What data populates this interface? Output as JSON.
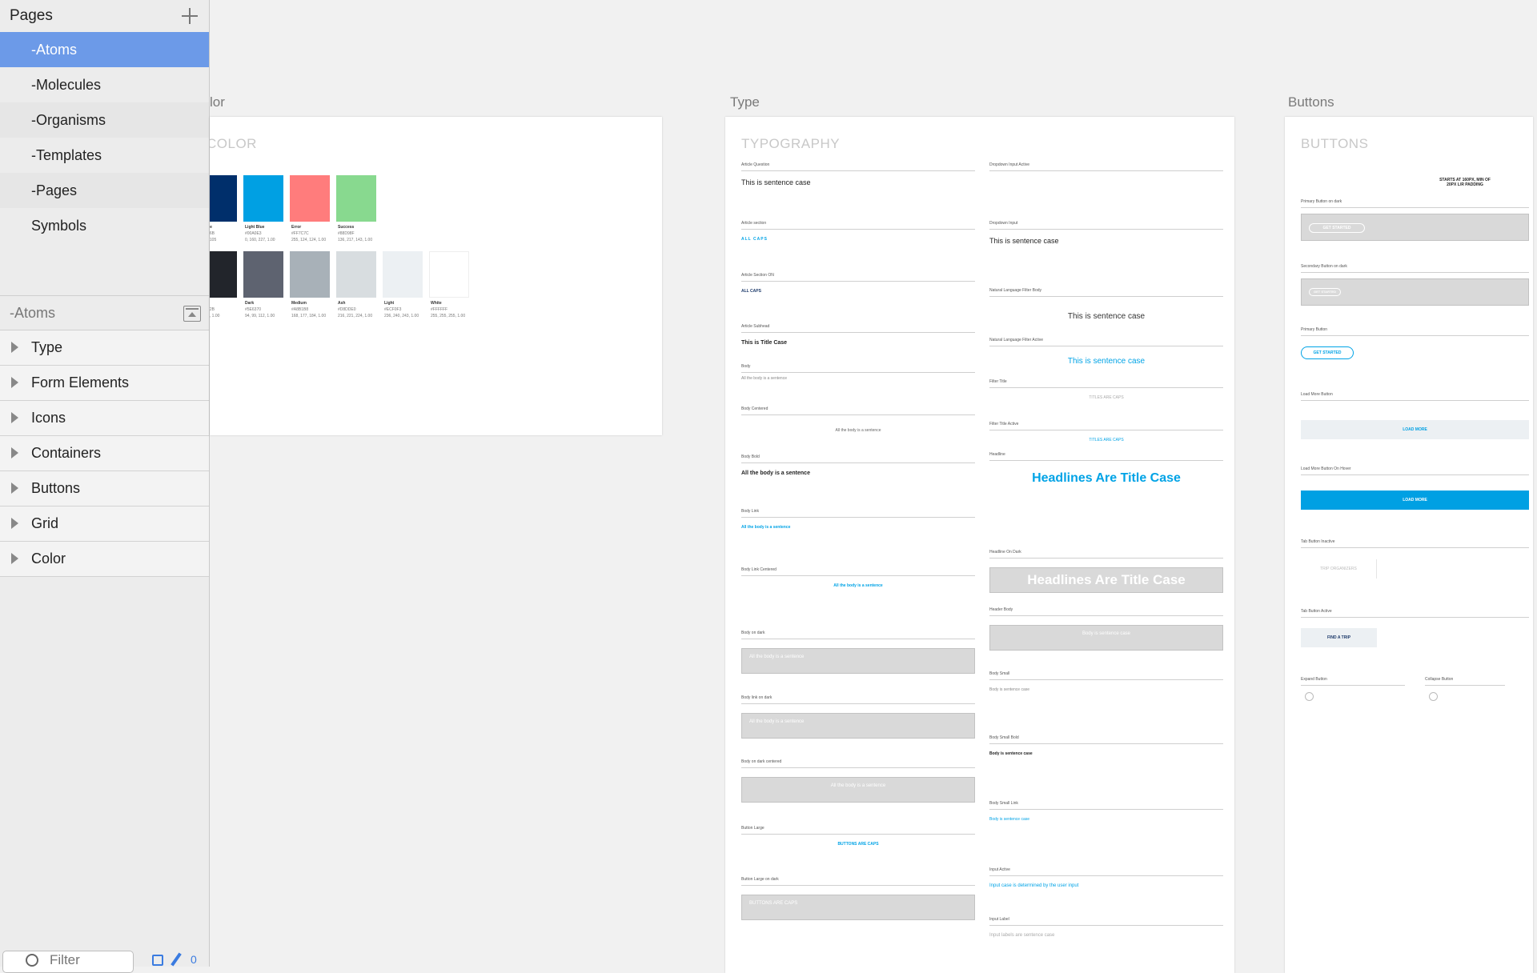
{
  "sidebar": {
    "pages_title": "Pages",
    "pages": [
      "-Atoms",
      "-Molecules",
      "-Organisms",
      "-Templates",
      "-Pages",
      "Symbols"
    ],
    "current_page": "-Atoms",
    "layers": [
      "Type",
      "Form Elements",
      "Icons",
      "Containers",
      "Buttons",
      "Grid",
      "Color"
    ],
    "filter_placeholder": "Filter",
    "count": "0"
  },
  "colors": {
    "accent": "#6c9ae8",
    "blue": "#00a3e6"
  },
  "color_board": {
    "label": "lor",
    "title": "COLOR",
    "swatches_row1": [
      {
        "name": "rk Blue",
        "hex": "#00306B",
        "rgb": "0, 47, 105",
        "color": "#002f6b"
      },
      {
        "name": "Light Blue",
        "hex": "#00A0E3",
        "rgb": "0, 160, 227, 1.00",
        "color": "#00a0e3"
      },
      {
        "name": "Error",
        "hex": "#FF7C7C",
        "rgb": "255, 124, 124, 1.00",
        "color": "#ff7c7c"
      },
      {
        "name": "Success",
        "hex": "#88D98F",
        "rgb": "136, 217, 143, 1.00",
        "color": "#88d98f"
      }
    ],
    "swatches_row2": [
      {
        "name": "ack",
        "hex": "#22252B",
        "rgb": "37, 41, 1.00",
        "color": "#22252b"
      },
      {
        "name": "Dark",
        "hex": "#5E6370",
        "rgb": "94, 99, 112, 1.00",
        "color": "#5e6370"
      },
      {
        "name": "Medium",
        "hex": "#A8B1B8",
        "rgb": "168, 177, 184, 1.00",
        "color": "#a8b1b8"
      },
      {
        "name": "Ash",
        "hex": "#D8DDE0",
        "rgb": "216, 221, 224, 1.00",
        "color": "#d8dde0"
      },
      {
        "name": "Light",
        "hex": "#ECF0F3",
        "rgb": "236, 240, 243, 1.00",
        "color": "#ecf0f3"
      },
      {
        "name": "White",
        "hex": "#FFFFFF",
        "rgb": "255, 255, 255, 1.00",
        "color": "#ffffff"
      }
    ]
  },
  "type_board": {
    "label": "Type",
    "title": "TYPOGRAPHY",
    "left": [
      {
        "label": "Article Question",
        "sample": "This is sentence case"
      },
      {
        "label": "Article section",
        "sample": "ALL CAPS"
      },
      {
        "label": "Article Section ON",
        "sample": "ALL CAPS"
      },
      {
        "label": "Article Subhead",
        "sample": "This is Title Case"
      },
      {
        "label": "Body",
        "sample": "All the body is a sentence"
      },
      {
        "label": "Body Centered",
        "sample": "All the body is a sentence"
      },
      {
        "label": "Body Bold",
        "sample": "All the body is a sentence"
      },
      {
        "label": "Body Link",
        "sample": "All the body is a sentence"
      },
      {
        "label": "Body Link Centered",
        "sample": "All the body is a sentence"
      },
      {
        "label": "Body on dark",
        "sample": "All the body is a sentence"
      },
      {
        "label": "Body link on dark",
        "sample": "All the body is a sentence"
      },
      {
        "label": "Body on dark centered",
        "sample": "All the body is a sentence"
      },
      {
        "label": "Button Large",
        "sample": "BUTTONS ARE CAPS"
      },
      {
        "label": "Button Large on dark",
        "sample": "BUTTONS ARE CAPS"
      }
    ],
    "right": [
      {
        "label": "Dropdown Input Active",
        "sample": ""
      },
      {
        "label": "Dropdown Input",
        "sample": "This is sentence case"
      },
      {
        "label": "Natural Language Filter Body",
        "sample": "This is sentence case"
      },
      {
        "label": "Natural Language Filter Active",
        "sample": "This is sentence case"
      },
      {
        "label": "Filter Title",
        "sample": "TITLES ARE CAPS"
      },
      {
        "label": "Filter Title Active",
        "sample": "TITLES ARE CAPS"
      },
      {
        "label": "Headline",
        "sample": "Headlines Are Title Case"
      },
      {
        "label": "Headline On Dark",
        "sample": "Headlines Are Title Case"
      },
      {
        "label": "Header Body",
        "sample": "Body is sentence case"
      },
      {
        "label": "Body Small",
        "sample": "Body is sentence case"
      },
      {
        "label": "Body Small Bold",
        "sample": "Body is sentence case"
      },
      {
        "label": "Body Small Link",
        "sample": "Body is sentence case"
      },
      {
        "label": "Input Active",
        "sample": "Input case is determined by the user input"
      },
      {
        "label": "Input Label",
        "sample": "Input labels are sentence case"
      }
    ]
  },
  "buttons_board": {
    "label": "Buttons",
    "title": "BUTTONS",
    "note": "STARTS AT 160PX, MIN OF 20PX L/R PADDING",
    "items": [
      {
        "label": "Primary Button on dark",
        "text": "GET STARTED"
      },
      {
        "label": "Secondary Button on dark",
        "text": "GET STARTED"
      },
      {
        "label": "Primary Button",
        "text": "GET STARTED"
      },
      {
        "label": "Load More Button",
        "text": "LOAD MORE"
      },
      {
        "label": "Load More Button On Hover",
        "text": "LOAD MORE"
      },
      {
        "label": "Tab Button Inactive",
        "text": "TRIP ORGANIZERS"
      },
      {
        "label": "Tab Button Active",
        "text": "FIND A TRIP"
      },
      {
        "label": "Expand Button",
        "text": ""
      },
      {
        "label": "Collapse Button",
        "text": ""
      }
    ]
  }
}
